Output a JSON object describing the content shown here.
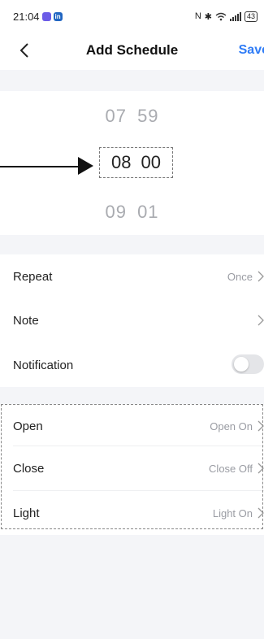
{
  "status_bar": {
    "time": "21:04",
    "icons": [
      "mail-app-icon",
      "linkedin-icon",
      "nfc-icon",
      "bluetooth-icon",
      "wifi-icon",
      "signal-icon"
    ],
    "app_badge": "in",
    "battery": "43"
  },
  "nav": {
    "title": "Add Schedule",
    "save": "Save"
  },
  "picker": {
    "prev": {
      "hour": "07",
      "minute": "59"
    },
    "selected": {
      "hour": "08",
      "minute": "00"
    },
    "next": {
      "hour": "09",
      "minute": "01"
    }
  },
  "settings": {
    "repeat": {
      "label": "Repeat",
      "value": "Once"
    },
    "note": {
      "label": "Note",
      "value": ""
    },
    "notification": {
      "label": "Notification",
      "enabled": false
    }
  },
  "actions": [
    {
      "label": "Open",
      "value": "Open On"
    },
    {
      "label": "Close",
      "value": "Close Off"
    },
    {
      "label": "Light",
      "value": "Light On"
    }
  ],
  "colors": {
    "accent": "#2f7cf6",
    "background": "#f4f5f8",
    "muted_text": "#9a9ca3",
    "toggle_off": "#e4e5e8"
  }
}
